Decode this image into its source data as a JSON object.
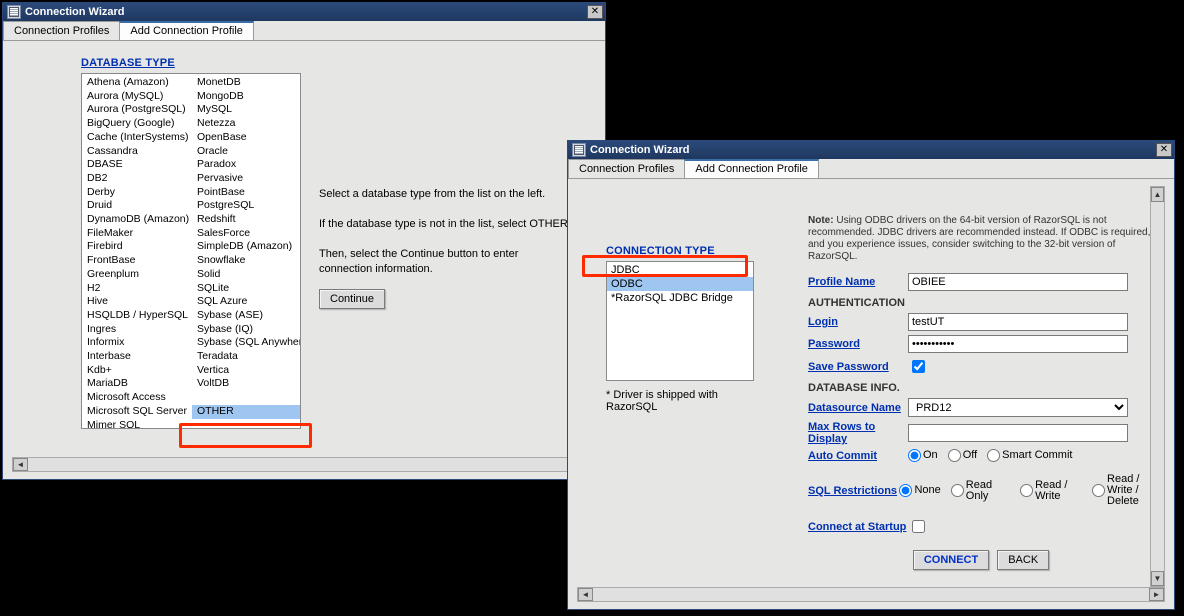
{
  "window1": {
    "title": "Connection Wizard",
    "tabs": [
      "Connection Profiles",
      "Add Connection Profile"
    ],
    "active_tab": 1,
    "section_header": "DATABASE TYPE",
    "db_col1": [
      "Athena (Amazon)",
      "Aurora (MySQL)",
      "Aurora (PostgreSQL)",
      "BigQuery (Google)",
      "Cache (InterSystems)",
      "Cassandra",
      "DBASE",
      "DB2",
      "Derby",
      "Druid",
      "DynamoDB (Amazon)",
      "FileMaker",
      "Firebird",
      "FrontBase",
      "Greenplum",
      "H2",
      "Hive",
      "HSQLDB / HyperSQL",
      "Ingres",
      "Informix",
      "Interbase",
      "Kdb+",
      "MariaDB",
      "Microsoft Access",
      "Microsoft SQL Server",
      "Mimer SQL"
    ],
    "db_col2": [
      "MonetDB",
      "MongoDB",
      "MySQL",
      "Netezza",
      "OpenBase",
      "Oracle",
      "Paradox",
      "Pervasive",
      "PointBase",
      "PostgreSQL",
      "Redshift",
      "SalesForce",
      "SimpleDB (Amazon)",
      "Snowflake",
      "Solid",
      "SQLite",
      "SQL Azure",
      "Sybase (ASE)",
      "Sybase (IQ)",
      "Sybase (SQL Anywhere)",
      "Teradata",
      "Vertica",
      "VoltDB",
      "",
      "OTHER"
    ],
    "selected": "OTHER",
    "instructions": {
      "l1": "Select a database type from the list on the left.",
      "l2": "If the database type is not in the list, select OTHER.",
      "l3": "Then, select the Continue button to enter",
      "l4": "connection information."
    },
    "continue": "Continue"
  },
  "window2": {
    "title": "Connection Wizard",
    "tabs": [
      "Connection Profiles",
      "Add Connection Profile"
    ],
    "active_tab": 1,
    "section_header": "CONNECTION TYPE",
    "conn_types": [
      "JDBC",
      "ODBC",
      "*RazorSQL JDBC Bridge"
    ],
    "selected": "ODBC",
    "driver_note": "* Driver is shipped with RazorSQL",
    "note_bold": "Note:",
    "note_text": "Using ODBC drivers on the 64-bit version of RazorSQL is not recommended. JDBC drivers are recommended instead. If ODBC is required, and you experience issues, consider switching to the 32-bit version of RazorSQL.",
    "labels": {
      "profile_name": "Profile Name",
      "auth": "AUTHENTICATION",
      "login": "Login",
      "password": "Password",
      "save_pw": "Save Password",
      "db_info": "DATABASE INFO.",
      "ds_name": "Datasource Name",
      "max_rows": "Max Rows to Display",
      "auto_commit": "Auto Commit",
      "sql_restrict": "SQL Restrictions",
      "connect_start": "Connect at Startup"
    },
    "values": {
      "profile_name": "OBIEE",
      "login": "testUT",
      "password": "•••••••••••",
      "save_pw": true,
      "ds_name": "PRD12",
      "max_rows": "",
      "auto_commit": "On",
      "sql_restrict": "None",
      "connect_start": false
    },
    "auto_commit_opts": [
      "On",
      "Off",
      "Smart Commit"
    ],
    "sql_restrict_opts": [
      "None",
      "Read Only",
      "Read / Write",
      "Read / Write / Delete"
    ],
    "buttons": {
      "connect": "CONNECT",
      "back": "BACK"
    }
  }
}
